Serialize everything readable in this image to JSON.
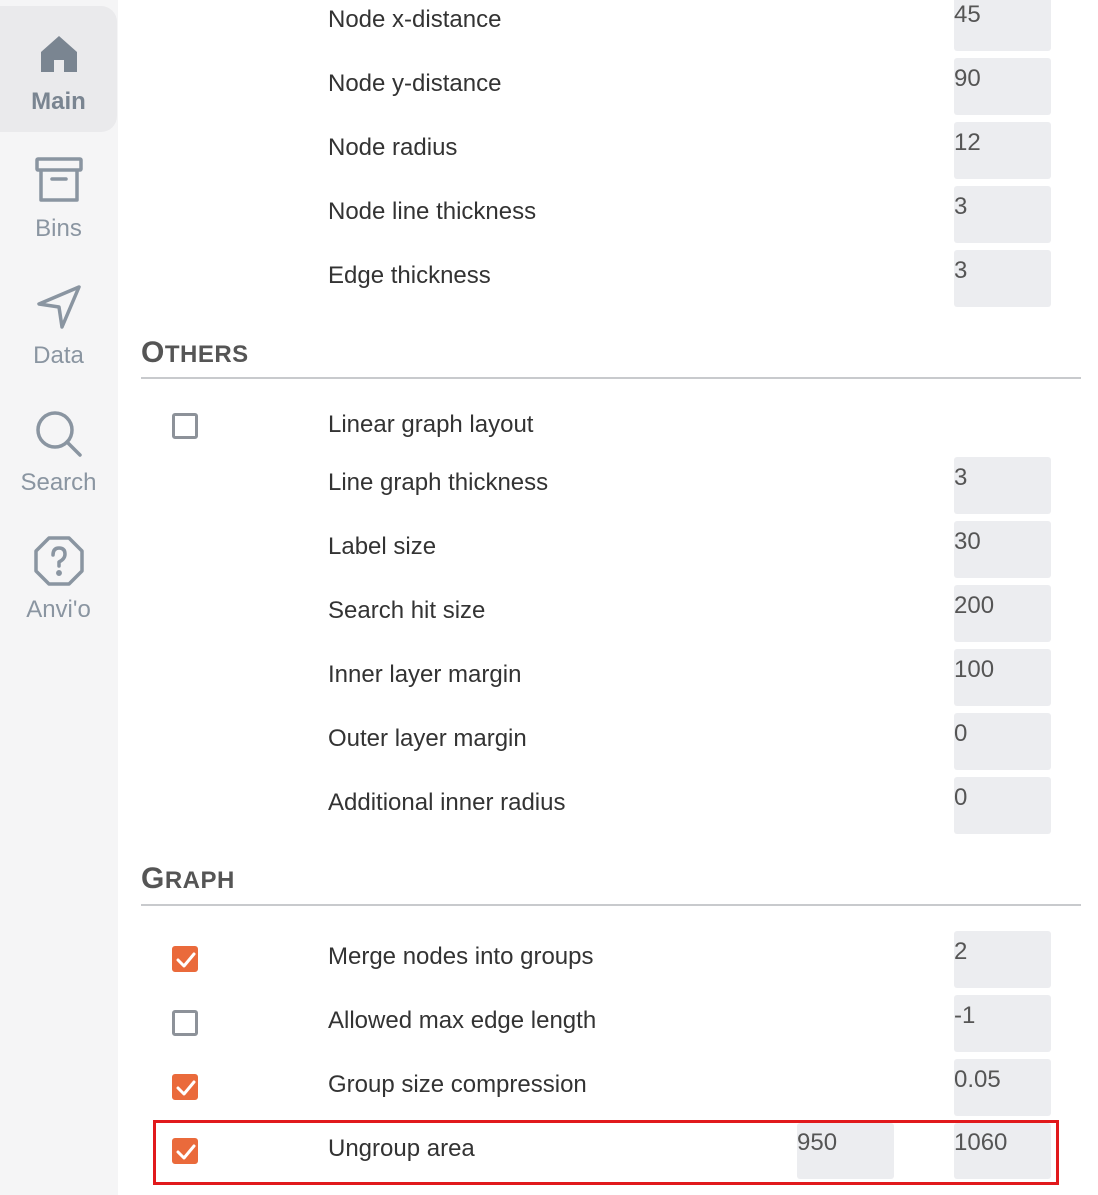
{
  "sidebar": {
    "items": [
      {
        "label": "Main",
        "icon": "home-icon",
        "active": true
      },
      {
        "label": "Bins",
        "icon": "archive-icon",
        "active": false
      },
      {
        "label": "Data",
        "icon": "send-icon",
        "active": false
      },
      {
        "label": "Search",
        "icon": "search-icon",
        "active": false
      },
      {
        "label": "Anvi'o",
        "icon": "help-icon",
        "active": false
      }
    ]
  },
  "node_settings": [
    {
      "label": "Node x-distance",
      "value": "45"
    },
    {
      "label": "Node y-distance",
      "value": "90"
    },
    {
      "label": "Node radius",
      "value": "12"
    },
    {
      "label": "Node line thickness",
      "value": "3"
    },
    {
      "label": "Edge thickness",
      "value": "3"
    }
  ],
  "others": {
    "title_cap": "O",
    "title_rest": "THERS",
    "linear_layout": {
      "label": "Linear graph layout",
      "checked": false
    },
    "settings": [
      {
        "label": "Line graph thickness",
        "value": "3"
      },
      {
        "label": "Label size",
        "value": "30"
      },
      {
        "label": "Search hit size",
        "value": "200"
      },
      {
        "label": "Inner layer margin",
        "value": "100"
      },
      {
        "label": "Outer layer margin",
        "value": "0"
      },
      {
        "label": "Additional inner radius",
        "value": "0"
      }
    ]
  },
  "graph": {
    "title_cap": "G",
    "title_rest": "RAPH",
    "settings": [
      {
        "label": "Merge nodes into groups",
        "value": "2",
        "checked": true
      },
      {
        "label": "Allowed max edge length",
        "value": "-1",
        "checked": false
      },
      {
        "label": "Group size compression",
        "value": "0.05",
        "checked": true
      }
    ],
    "ungroup": {
      "label": "Ungroup area",
      "from": "950",
      "to": "1060",
      "checked": true
    }
  },
  "colors": {
    "accent": "#ea6a3b",
    "highlight": "#e1191c",
    "input_bg": "#ecedf0",
    "sidebar_bg": "#f5f5f6"
  }
}
